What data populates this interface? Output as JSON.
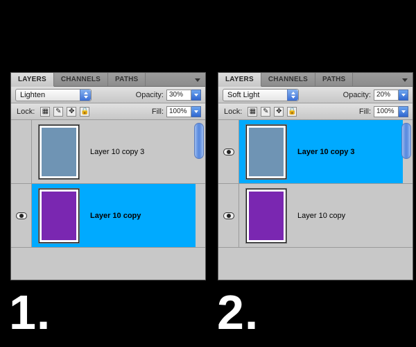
{
  "labels": {
    "one": "1.",
    "two": "2."
  },
  "tabs": {
    "layers": "LAYERS",
    "channels": "CHANNELS",
    "paths": "PATHS"
  },
  "ctrl": {
    "opacity": "Opacity:",
    "lock": "Lock:",
    "fill": "Fill:"
  },
  "panel1": {
    "blend_mode": "Lighten",
    "opacity": "30%",
    "fill": "100%",
    "selected_index": 1,
    "layers": [
      {
        "name": "Layer 10 copy 3",
        "visible": false,
        "thumb_color": "#6f94b4"
      },
      {
        "name": "Layer 10 copy",
        "visible": true,
        "thumb_color": "#7a27b1"
      }
    ]
  },
  "panel2": {
    "blend_mode": "Soft Light",
    "opacity": "20%",
    "fill": "100%",
    "selected_index": 0,
    "layers": [
      {
        "name": "Layer 10 copy 3",
        "visible": true,
        "thumb_color": "#6f94b4"
      },
      {
        "name": "Layer 10 copy",
        "visible": true,
        "thumb_color": "#7a27b1"
      }
    ]
  }
}
